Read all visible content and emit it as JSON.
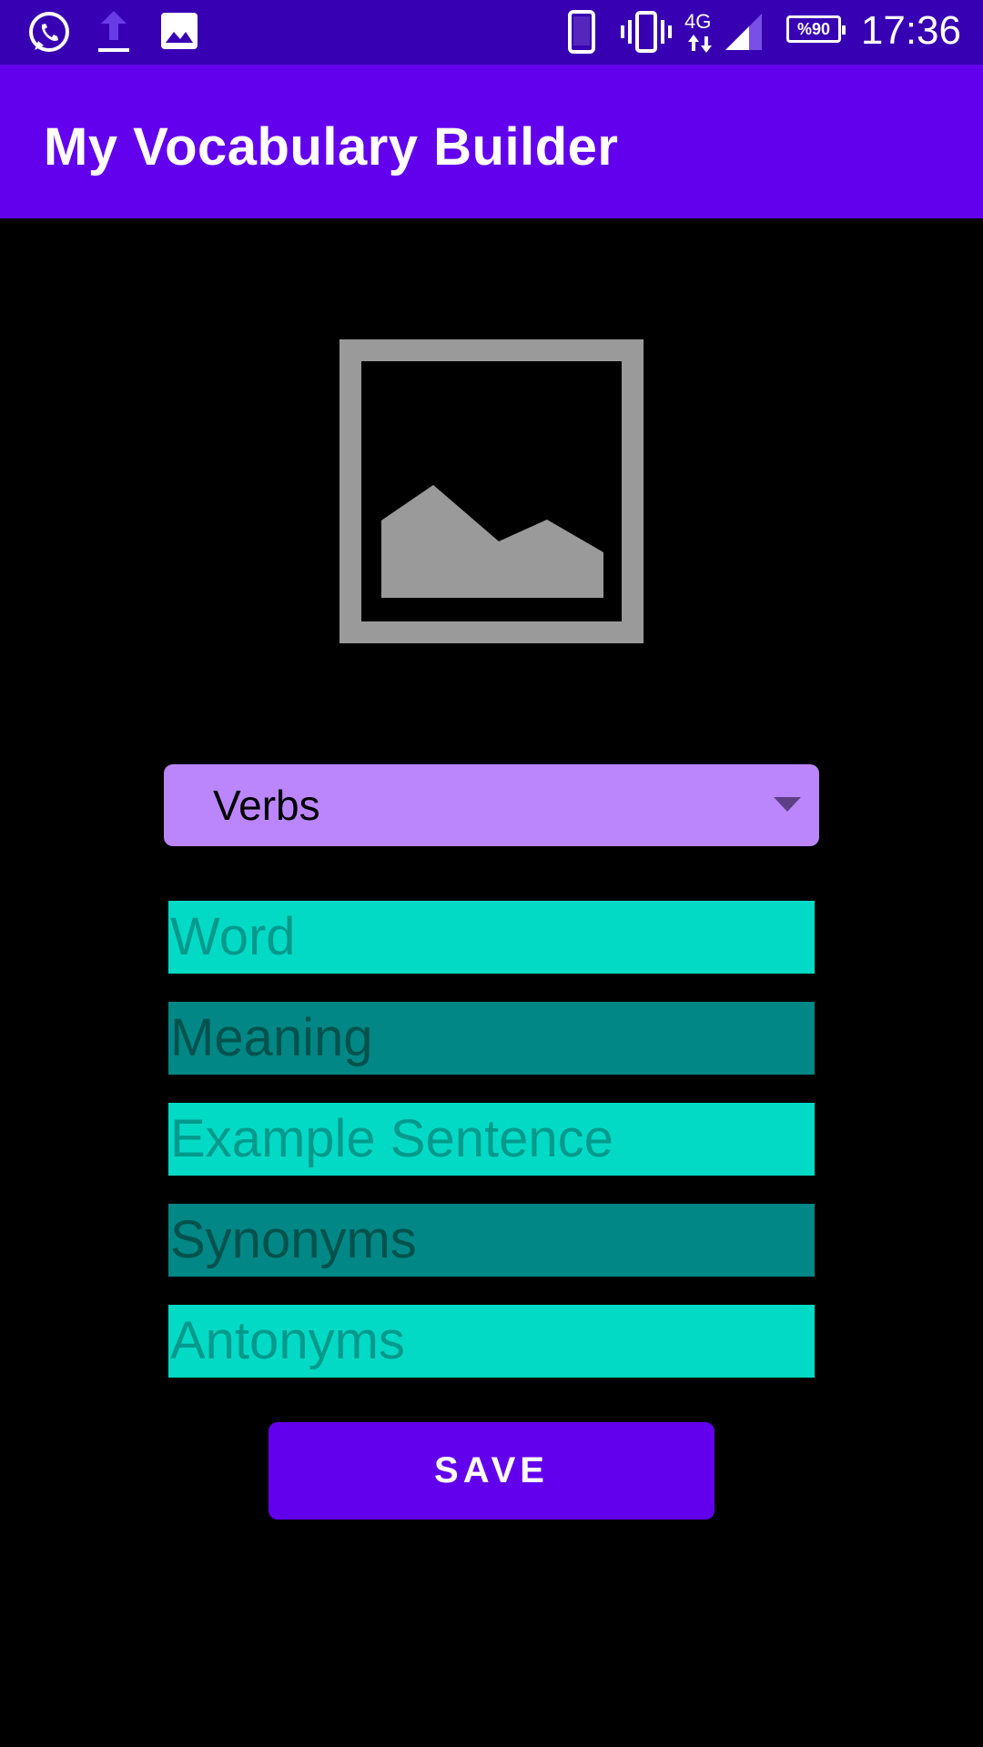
{
  "status_bar": {
    "time": "17:36",
    "battery_label": "%90",
    "network_label": "4G",
    "left_icons": [
      "whatsapp-icon",
      "upload-icon",
      "gallery-icon"
    ],
    "right_icons": [
      "phone-icon",
      "vibrate-icon",
      "network-4g-icon",
      "signal-icon",
      "battery-icon"
    ]
  },
  "app_bar": {
    "title": "My Vocabulary Builder"
  },
  "image_placeholder": {
    "icon": "image-placeholder-icon"
  },
  "category_spinner": {
    "selected": "Verbs"
  },
  "form": {
    "word_placeholder": "Word",
    "meaning_placeholder": "Meaning",
    "example_placeholder": "Example Sentence",
    "synonyms_placeholder": "Synonyms",
    "antonyms_placeholder": "Antonyms"
  },
  "actions": {
    "save_label": "SAVE"
  },
  "colors": {
    "status_bar": "#3700b3",
    "primary": "#6200ee",
    "spinner_bg": "#bb86fc",
    "field_light": "#03dac5",
    "field_dark": "#018786",
    "background": "#000000"
  }
}
